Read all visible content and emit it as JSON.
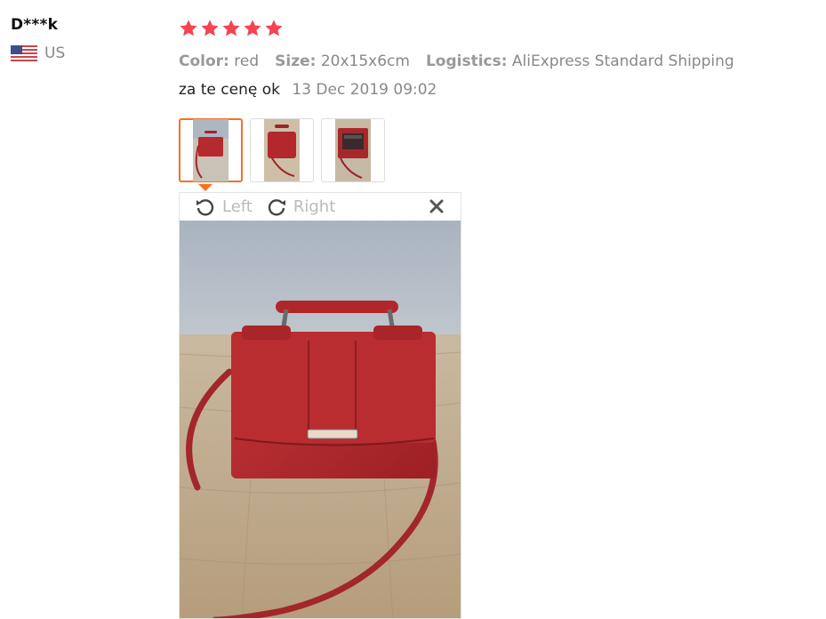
{
  "user": {
    "name": "D***k",
    "country": "US",
    "flag_icon": "us-flag-icon"
  },
  "review": {
    "rating": 5,
    "rating_max": 5,
    "star_color": "#f5444f",
    "attributes": [
      {
        "key": "Color:",
        "value": "red"
      },
      {
        "key": "Size:",
        "value": "20x15x6cm"
      },
      {
        "key": "Logistics:",
        "value": "AliExpress Standard Shipping"
      }
    ],
    "feedback_text": "za te cenę ok",
    "date": "13 Dec 2019 09:02"
  },
  "images": {
    "thumbnails": [
      {
        "subject": "red handbag front",
        "selected": true
      },
      {
        "subject": "red handbag side",
        "selected": false
      },
      {
        "subject": "red handbag open",
        "selected": false
      }
    ],
    "active_color": "#f57224"
  },
  "viewer": {
    "rotate_left_label": "Left",
    "rotate_right_label": "Right",
    "close_icon": "close-icon"
  }
}
